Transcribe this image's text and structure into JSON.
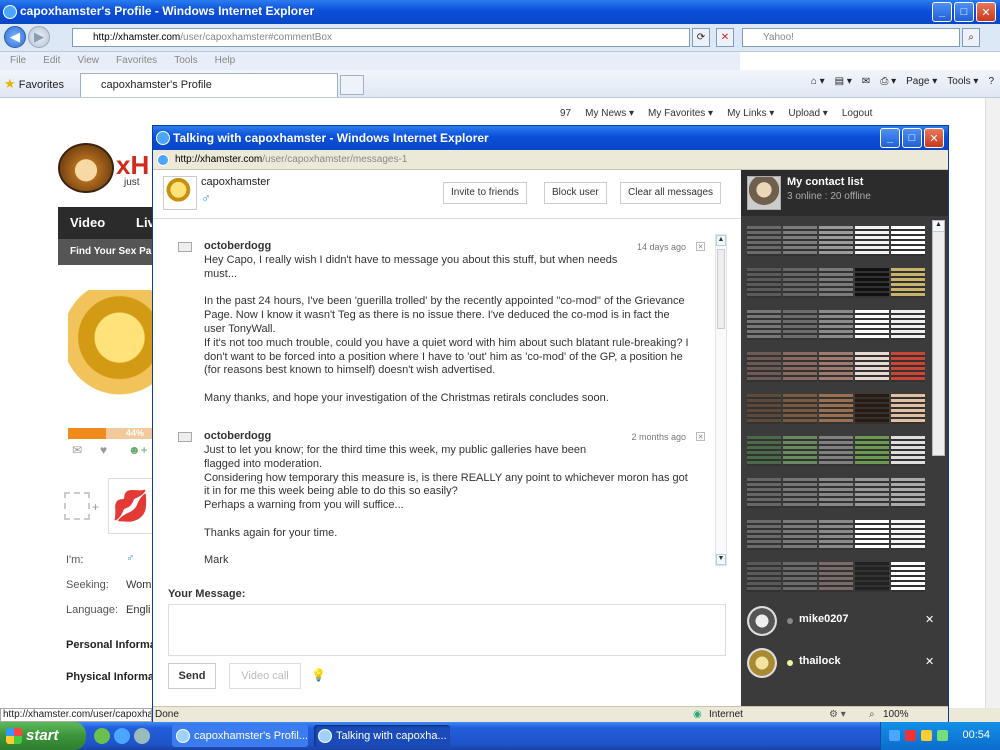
{
  "outer": {
    "title": "capoxhamster's Profile - Windows Internet Explorer",
    "url_domain": "http://xhamster.com",
    "url_path": "/user/capoxhamster#commentBox",
    "search_placeholder": "Yahoo!",
    "menu": [
      "File",
      "Edit",
      "View",
      "Favorites",
      "Tools",
      "Help"
    ],
    "favorites_label": "Favorites",
    "tab_label": "capoxhamster's Profile",
    "command_bar": [
      "Page ▾",
      "Tools ▾",
      "?"
    ],
    "status_url": "http://xhamster.com/user/capoxham"
  },
  "site": {
    "top_nav": [
      "97",
      "My News ▾",
      "My Favorites ▾",
      "My Links ▾",
      "Upload ▾",
      "Logout"
    ],
    "logo_text": "xH",
    "logo_sub": "just",
    "nav_items": [
      "Video",
      "Liv"
    ],
    "nav_sub": "Find Your Sex Pa",
    "progress_label": "44%",
    "progress_value": 0.44,
    "profile_fields": [
      {
        "label": "I'm:",
        "value": "♂"
      },
      {
        "label": "Seeking:",
        "value": "Wom"
      },
      {
        "label": "Language:",
        "value": "Engli"
      }
    ],
    "profile_headings": [
      "Personal Informa",
      "Physical Informat"
    ]
  },
  "popup": {
    "title": "Talking with capoxhamster - Windows Internet Explorer",
    "url_domain": "http://xhamster.com",
    "url_path": "/user/capoxhamster/messages-1",
    "chat_user": "capoxhamster",
    "buttons": {
      "invite": "Invite to friends",
      "block": "Block user",
      "clear": "Clear all messages"
    },
    "messages": [
      {
        "from": "octoberdogg",
        "time": "14 days ago",
        "body": "Hey Capo, I really wish I didn't have to message you about this stuff, but when needs\nmust...\n\nIn the past 24 hours, I've been 'guerilla trolled' by the recently appointed \"co-mod\" of the Grievance\nPage. Now I know it wasn't Teg as there is no issue there. I've deduced the co-mod is in fact the\nuser TonyWall.\nIf it's not too much trouble, could you have a quiet word with him about such blatant rule-breaking? I\ndon't want to be forced into a position where I have to 'out' him as 'co-mod' of the GP, a position he\n(for reasons best known to himself) doesn't wish advertised.\n\nMany thanks, and hope your investigation of the Christmas retirals concludes soon."
      },
      {
        "from": "octoberdogg",
        "time": "2 months ago",
        "body": "Just to let you know; for the third time this week, my public galleries have been\nflagged into moderation.\nConsidering how temporary this measure is, is there REALLY any point to whichever moron has got\nit in for me this week being able to do this so easily?\nPerhaps a warning from you will suffice...\n\nThanks again for your time.\n\nMark"
      }
    ],
    "your_message_label": "Your Message:",
    "send_label": "Send",
    "video_call_label": "Video call",
    "status_done": "Done",
    "status_zone": "Internet",
    "zoom": "100%"
  },
  "contacts": {
    "title": "My contact list",
    "subtitle": "3 online : 20 offline",
    "users": [
      {
        "name": "mike0207",
        "status_color": "#888888"
      },
      {
        "name": "thailock",
        "status_color": "#f2f2a0"
      }
    ]
  },
  "taskbar": {
    "start_label": "start",
    "tasks": [
      "capoxhamster's Profil...",
      "Talking with capoxha..."
    ],
    "clock": "00:54"
  }
}
